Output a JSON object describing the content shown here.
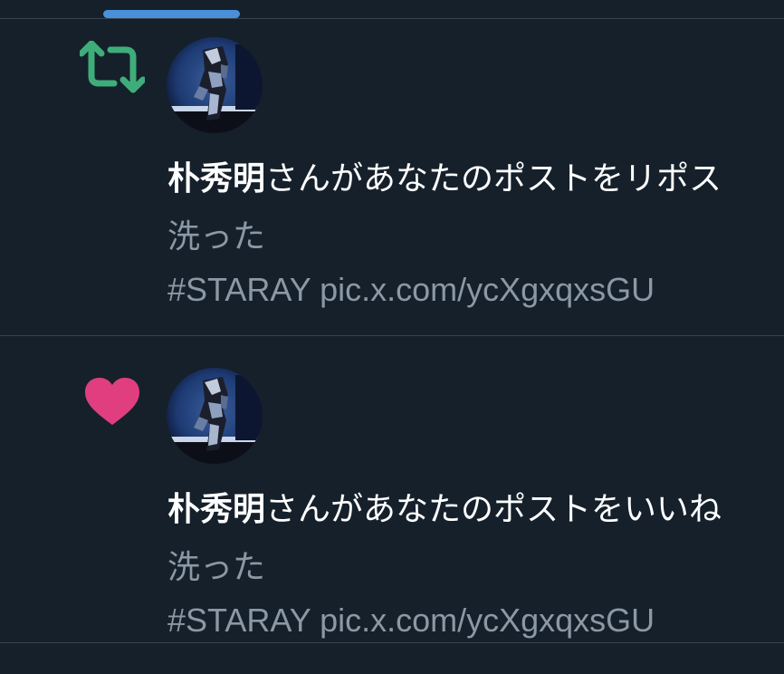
{
  "colors": {
    "background": "#15202b",
    "divider": "#38444d",
    "tab_indicator": "#4a90d9",
    "repost_icon": "#3fad7a",
    "like_icon": "#e03e7f",
    "secondary_text": "#8b98a5"
  },
  "notifications": [
    {
      "type": "repost",
      "icon": "repost-icon",
      "user_name": "朴秀明",
      "action_text": "さんがあなたのポストをリポス",
      "post_text": "洗った",
      "post_tags_link": "#STARAY pic.x.com/ycXgxqxsGU"
    },
    {
      "type": "like",
      "icon": "heart-icon",
      "user_name": "朴秀明",
      "action_text": "さんがあなたのポストをいいね",
      "post_text": "洗った",
      "post_tags_link": "#STARAY pic.x.com/ycXgxqxsGU"
    }
  ]
}
